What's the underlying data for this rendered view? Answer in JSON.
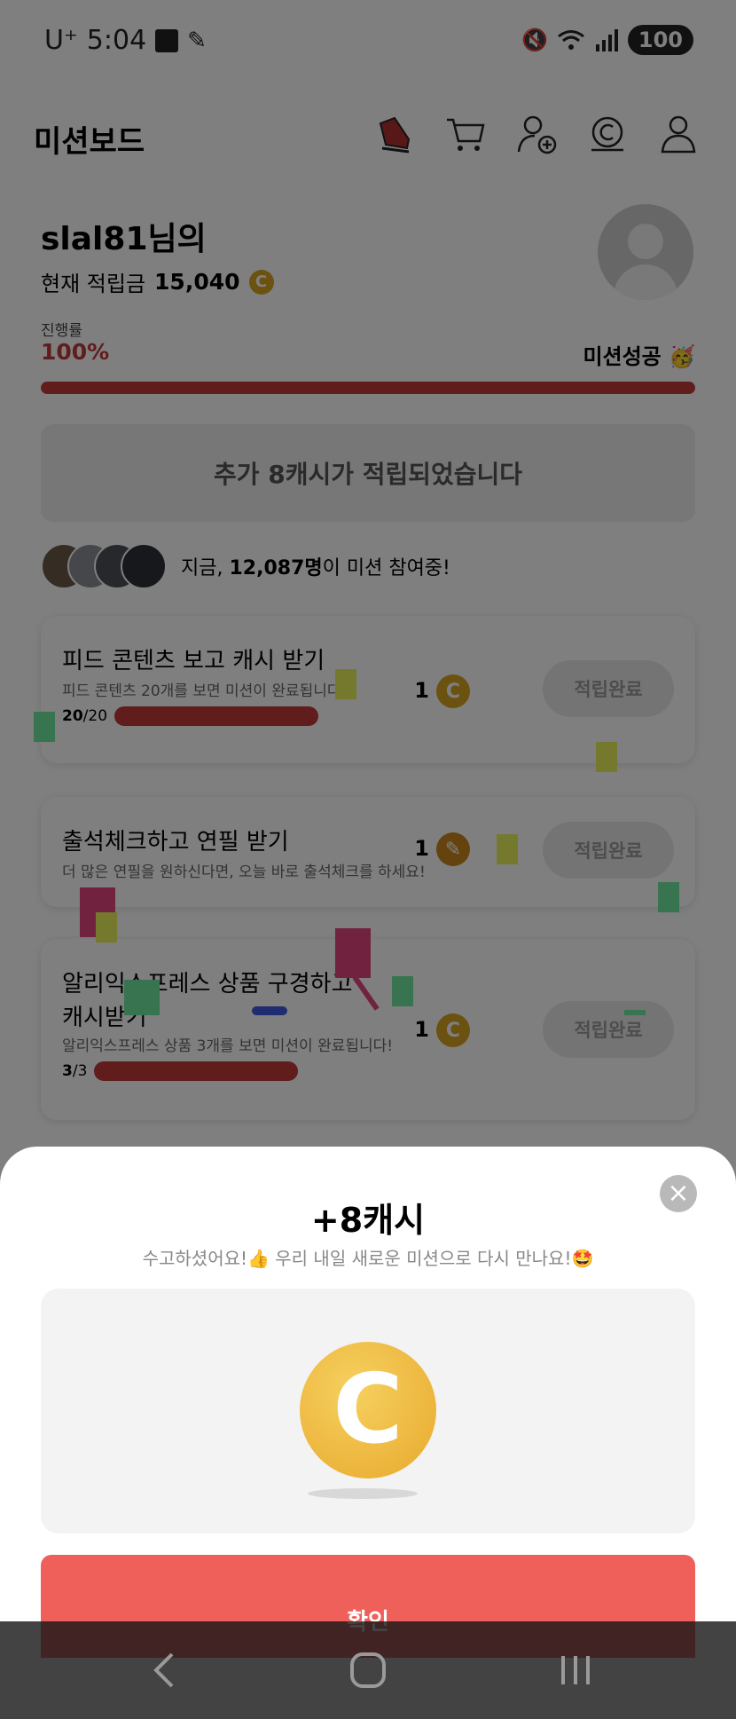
{
  "status_bar": {
    "carrier": "U⁺",
    "time": "5:04",
    "battery": "100"
  },
  "header": {
    "title": "미션보드",
    "icons": [
      "shoe-icon",
      "cart-icon",
      "add-friend-icon",
      "cash-coin-icon",
      "profile-icon"
    ]
  },
  "user": {
    "name": "slal81님의",
    "balance_label": "현재 적립금",
    "balance": "15,040",
    "coin_symbol": "C"
  },
  "progress": {
    "label": "진행률",
    "percent_text": "100%",
    "value": 1.0,
    "success_text": "미션성공 🥳"
  },
  "notice": {
    "text": "추가 8캐시가 적립되었습니다"
  },
  "participants": {
    "prefix": "지금,",
    "count": "12,087명",
    "suffix": "이 미션 참여중!"
  },
  "missions": [
    {
      "title": "피드 콘텐츠 보고 캐시 받기",
      "desc": "피드 콘텐츠 20개를 보면 미션이 완료됩니다.",
      "done": "20",
      "total": "/20",
      "reward": "1",
      "button": "적립완료"
    },
    {
      "title": "출석체크하고 연필 받기",
      "desc": "더 많은 연필을 원하신다면, 오늘 바로 출석체크를 하세요!",
      "reward": "1",
      "button": "적립완료"
    },
    {
      "title": "알리익스프레스 상품 구경하고",
      "title2": "캐시받기",
      "desc": "알리익스프레스 상품 3개를 보면 미션이 완료됩니다!",
      "done": "3",
      "total": "/3",
      "reward": "1",
      "button": "적립완료"
    }
  ],
  "sheet": {
    "title": "+8캐시",
    "subtitle": "수고하셨어요!👍 우리 내일 새로운 미션으로 다시 만나요!🤩",
    "coin_symbol": "C",
    "confirm": "확인"
  },
  "colors": {
    "accent_red": "#c23838",
    "confirm_button": "#f0605a",
    "coin_gold": "#e8a92c",
    "confetti_pink": "#e2457f",
    "confetti_yellow": "#e9f25c",
    "confetti_green": "#6ee89e",
    "confetti_blue": "#3f5be0"
  }
}
